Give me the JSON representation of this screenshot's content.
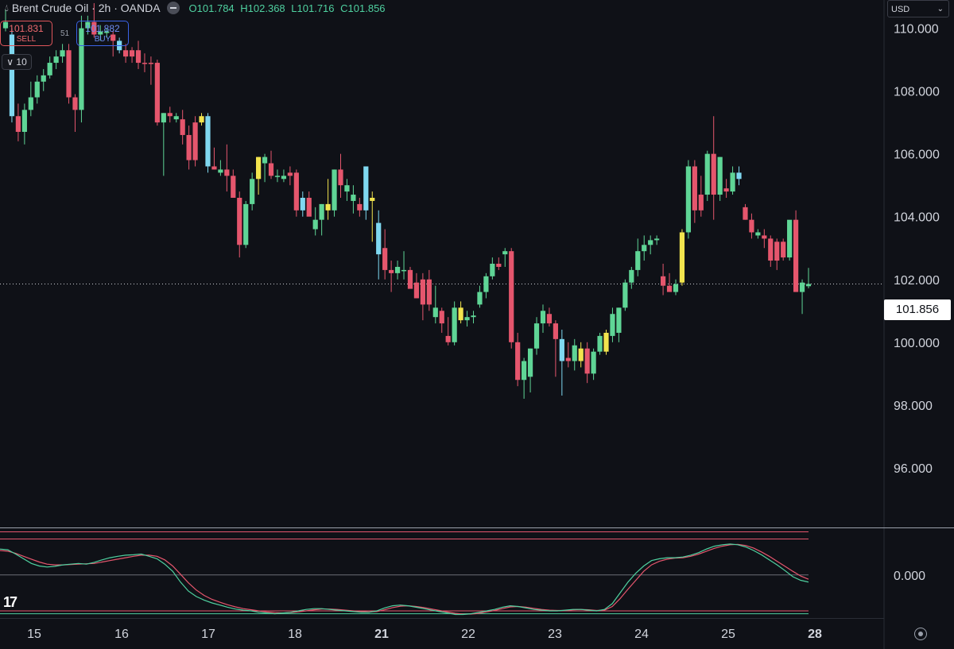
{
  "header": {
    "symbol_line": "Brent Crude Oil · 2h · OANDA",
    "open": "O101.784",
    "high": "H102.368",
    "low": "L101.716",
    "close": "C101.856"
  },
  "trade": {
    "sell_price": "101.831",
    "sell_label": "SELL",
    "spread": "51",
    "buy_price": "101.882",
    "buy_label": "BUY"
  },
  "volume_toggle": "10",
  "currency": "USD",
  "current_price_label": "101.856",
  "logo_text": "17",
  "colors": {
    "bg": "#0f1117",
    "up": "#5fd596",
    "down": "#e5566d",
    "up_alt": "#7fd8f0",
    "down_alt": "#f2e44e",
    "osc_fast": "#4fd1a0",
    "osc_slow": "#e5566d",
    "osc_band": "#e5566d",
    "grid_line": "#3a3d47"
  },
  "chart_data": {
    "type": "candlestick",
    "y_axis": {
      "ticks": [
        "110.000",
        "108.000",
        "106.000",
        "104.000",
        "102.000",
        "100.000",
        "98.000",
        "96.000"
      ],
      "tick_values": [
        110,
        108,
        106,
        104,
        102,
        100,
        98,
        96
      ],
      "ylim": [
        94.1,
        110.9
      ]
    },
    "x_axis": {
      "ticks": [
        "15",
        "16",
        "17",
        "18",
        "21",
        "22",
        "23",
        "24",
        "25",
        "28"
      ],
      "bold_ticks": [
        "21",
        "28"
      ]
    },
    "current_price": 101.856,
    "candles": [
      {
        "o": 110.2,
        "h": 110.6,
        "l": 109.9,
        "c": 110.0,
        "s": "up"
      },
      {
        "o": 109.8,
        "h": 110.0,
        "l": 107.0,
        "c": 107.2,
        "s": "up_alt"
      },
      {
        "o": 107.2,
        "h": 107.6,
        "l": 106.4,
        "c": 106.7,
        "s": "down"
      },
      {
        "o": 106.7,
        "h": 107.6,
        "l": 106.3,
        "c": 107.4,
        "s": "up"
      },
      {
        "o": 107.4,
        "h": 108.3,
        "l": 107.2,
        "c": 107.8,
        "s": "up"
      },
      {
        "o": 107.8,
        "h": 108.5,
        "l": 107.6,
        "c": 108.3,
        "s": "up"
      },
      {
        "o": 108.3,
        "h": 108.7,
        "l": 108.0,
        "c": 108.5,
        "s": "up"
      },
      {
        "o": 108.5,
        "h": 109.1,
        "l": 108.4,
        "c": 108.9,
        "s": "up"
      },
      {
        "o": 108.9,
        "h": 109.3,
        "l": 108.7,
        "c": 109.1,
        "s": "up"
      },
      {
        "o": 109.1,
        "h": 109.5,
        "l": 108.9,
        "c": 109.3,
        "s": "up"
      },
      {
        "o": 109.3,
        "h": 109.5,
        "l": 107.6,
        "c": 107.8,
        "s": "down"
      },
      {
        "o": 107.8,
        "h": 107.9,
        "l": 106.7,
        "c": 107.4,
        "s": "down"
      },
      {
        "o": 107.4,
        "h": 110.4,
        "l": 107.0,
        "c": 110.0,
        "s": "up"
      },
      {
        "o": 110.0,
        "h": 110.4,
        "l": 109.8,
        "c": 110.2,
        "s": "up"
      },
      {
        "o": 110.2,
        "h": 110.8,
        "l": 109.7,
        "c": 109.8,
        "s": "down"
      },
      {
        "o": 109.8,
        "h": 110.1,
        "l": 109.6,
        "c": 109.9,
        "s": "up"
      },
      {
        "o": 109.9,
        "h": 110.0,
        "l": 109.7,
        "c": 109.85,
        "s": "up"
      },
      {
        "o": 109.8,
        "h": 109.9,
        "l": 109.1,
        "c": 109.6,
        "s": "down"
      },
      {
        "o": 109.6,
        "h": 109.7,
        "l": 109.2,
        "c": 109.3,
        "s": "up_alt"
      },
      {
        "o": 109.3,
        "h": 109.5,
        "l": 108.9,
        "c": 109.1,
        "s": "down"
      },
      {
        "o": 109.1,
        "h": 109.4,
        "l": 108.9,
        "c": 109.3,
        "s": "down"
      },
      {
        "o": 109.3,
        "h": 109.6,
        "l": 108.7,
        "c": 108.9,
        "s": "down"
      },
      {
        "o": 108.9,
        "h": 109.2,
        "l": 108.6,
        "c": 108.9,
        "s": "down"
      },
      {
        "o": 108.9,
        "h": 109.1,
        "l": 108.2,
        "c": 108.9,
        "s": "down"
      },
      {
        "o": 108.9,
        "h": 109.0,
        "l": 106.9,
        "c": 107.0,
        "s": "down"
      },
      {
        "o": 107.0,
        "h": 107.3,
        "l": 105.3,
        "c": 107.3,
        "s": "up"
      },
      {
        "o": 107.3,
        "h": 107.5,
        "l": 107.0,
        "c": 107.2,
        "s": "down"
      },
      {
        "o": 107.2,
        "h": 107.3,
        "l": 107.0,
        "c": 107.1,
        "s": "up"
      },
      {
        "o": 107.1,
        "h": 107.4,
        "l": 106.3,
        "c": 106.6,
        "s": "down"
      },
      {
        "o": 106.6,
        "h": 106.9,
        "l": 105.5,
        "c": 105.8,
        "s": "down"
      },
      {
        "o": 105.8,
        "h": 107.2,
        "l": 105.6,
        "c": 107.0,
        "s": "down"
      },
      {
        "o": 107.0,
        "h": 107.3,
        "l": 106.9,
        "c": 107.2,
        "s": "down_alt"
      },
      {
        "o": 107.2,
        "h": 107.3,
        "l": 105.4,
        "c": 105.6,
        "s": "up_alt"
      },
      {
        "o": 105.6,
        "h": 106.2,
        "l": 105.5,
        "c": 105.5,
        "s": "down"
      },
      {
        "o": 105.5,
        "h": 105.8,
        "l": 105.3,
        "c": 105.4,
        "s": "up"
      },
      {
        "o": 105.5,
        "h": 106.3,
        "l": 104.8,
        "c": 105.3,
        "s": "down"
      },
      {
        "o": 105.3,
        "h": 105.5,
        "l": 104.6,
        "c": 104.6,
        "s": "down"
      },
      {
        "o": 104.6,
        "h": 104.8,
        "l": 102.7,
        "c": 103.1,
        "s": "down"
      },
      {
        "o": 103.1,
        "h": 104.5,
        "l": 103.0,
        "c": 104.4,
        "s": "up"
      },
      {
        "o": 104.4,
        "h": 105.4,
        "l": 104.2,
        "c": 105.2,
        "s": "up"
      },
      {
        "o": 105.2,
        "h": 105.9,
        "l": 104.7,
        "c": 105.9,
        "s": "down_alt"
      },
      {
        "o": 105.9,
        "h": 106.0,
        "l": 105.1,
        "c": 105.7,
        "s": "up"
      },
      {
        "o": 105.7,
        "h": 106.1,
        "l": 105.2,
        "c": 105.3,
        "s": "down"
      },
      {
        "o": 105.3,
        "h": 105.5,
        "l": 105.1,
        "c": 105.3,
        "s": "up"
      },
      {
        "o": 105.3,
        "h": 105.5,
        "l": 105.1,
        "c": 105.2,
        "s": "up"
      },
      {
        "o": 105.3,
        "h": 105.6,
        "l": 105.0,
        "c": 105.4,
        "s": "down"
      },
      {
        "o": 105.4,
        "h": 105.5,
        "l": 104.0,
        "c": 104.2,
        "s": "down"
      },
      {
        "o": 104.2,
        "h": 104.8,
        "l": 104.0,
        "c": 104.6,
        "s": "up_alt"
      },
      {
        "o": 104.6,
        "h": 104.8,
        "l": 104.1,
        "c": 104.0,
        "s": "down"
      },
      {
        "o": 103.6,
        "h": 104.3,
        "l": 103.4,
        "c": 103.9,
        "s": "up"
      },
      {
        "o": 103.9,
        "h": 104.4,
        "l": 103.4,
        "c": 104.4,
        "s": "up"
      },
      {
        "o": 104.4,
        "h": 105.2,
        "l": 103.9,
        "c": 104.2,
        "s": "down_alt"
      },
      {
        "o": 104.2,
        "h": 105.5,
        "l": 104.0,
        "c": 105.5,
        "s": "up"
      },
      {
        "o": 105.5,
        "h": 106.0,
        "l": 104.6,
        "c": 105.0,
        "s": "down"
      },
      {
        "o": 105.0,
        "h": 105.2,
        "l": 104.5,
        "c": 104.8,
        "s": "up"
      },
      {
        "o": 104.7,
        "h": 105.0,
        "l": 104.1,
        "c": 104.5,
        "s": "up"
      },
      {
        "o": 104.4,
        "h": 104.6,
        "l": 104.0,
        "c": 104.2,
        "s": "down"
      },
      {
        "o": 104.2,
        "h": 105.6,
        "l": 103.9,
        "c": 105.6,
        "s": "up_alt"
      },
      {
        "o": 104.6,
        "h": 104.8,
        "l": 103.2,
        "c": 104.5,
        "s": "down_alt"
      },
      {
        "o": 103.8,
        "h": 104.2,
        "l": 102.0,
        "c": 102.8,
        "s": "up_alt"
      },
      {
        "o": 103.0,
        "h": 103.6,
        "l": 102.0,
        "c": 102.3,
        "s": "down"
      },
      {
        "o": 102.3,
        "h": 102.6,
        "l": 101.6,
        "c": 102.2,
        "s": "down"
      },
      {
        "o": 102.2,
        "h": 102.6,
        "l": 102.0,
        "c": 102.4,
        "s": "up"
      },
      {
        "o": 102.3,
        "h": 102.9,
        "l": 102.0,
        "c": 102.3,
        "s": "up"
      },
      {
        "o": 102.3,
        "h": 102.4,
        "l": 101.9,
        "c": 101.7,
        "s": "down"
      },
      {
        "o": 101.9,
        "h": 102.2,
        "l": 101.4,
        "c": 101.4,
        "s": "down"
      },
      {
        "o": 101.2,
        "h": 102.2,
        "l": 100.7,
        "c": 102.0,
        "s": "down"
      },
      {
        "o": 102.0,
        "h": 102.3,
        "l": 101.0,
        "c": 101.2,
        "s": "down"
      },
      {
        "o": 101.1,
        "h": 101.8,
        "l": 100.6,
        "c": 100.8,
        "s": "up"
      },
      {
        "o": 100.6,
        "h": 101.1,
        "l": 100.3,
        "c": 101.0,
        "s": "down"
      },
      {
        "o": 100.2,
        "h": 100.8,
        "l": 99.9,
        "c": 100.0,
        "s": "down"
      },
      {
        "o": 100.0,
        "h": 101.3,
        "l": 99.9,
        "c": 101.1,
        "s": "up"
      },
      {
        "o": 101.1,
        "h": 101.3,
        "l": 100.6,
        "c": 100.7,
        "s": "down_alt"
      },
      {
        "o": 100.7,
        "h": 101.0,
        "l": 100.5,
        "c": 100.8,
        "s": "up"
      },
      {
        "o": 100.8,
        "h": 101.0,
        "l": 100.6,
        "c": 100.85,
        "s": "up"
      },
      {
        "o": 101.2,
        "h": 101.8,
        "l": 101.1,
        "c": 101.6,
        "s": "up"
      },
      {
        "o": 101.6,
        "h": 102.2,
        "l": 101.4,
        "c": 102.1,
        "s": "up"
      },
      {
        "o": 102.1,
        "h": 102.7,
        "l": 102.0,
        "c": 102.5,
        "s": "up"
      },
      {
        "o": 102.5,
        "h": 102.7,
        "l": 102.3,
        "c": 102.4,
        "s": "down"
      },
      {
        "o": 102.8,
        "h": 103.0,
        "l": 102.4,
        "c": 102.9,
        "s": "up"
      },
      {
        "o": 102.9,
        "h": 103.0,
        "l": 99.8,
        "c": 100.0,
        "s": "down"
      },
      {
        "o": 100.0,
        "h": 100.3,
        "l": 98.6,
        "c": 98.8,
        "s": "down"
      },
      {
        "o": 98.8,
        "h": 99.5,
        "l": 98.2,
        "c": 99.4,
        "s": "up"
      },
      {
        "o": 98.9,
        "h": 99.8,
        "l": 98.4,
        "c": 99.8,
        "s": "up"
      },
      {
        "o": 99.8,
        "h": 100.8,
        "l": 99.6,
        "c": 100.6,
        "s": "up"
      },
      {
        "o": 100.6,
        "h": 101.2,
        "l": 100.3,
        "c": 101.0,
        "s": "up"
      },
      {
        "o": 100.9,
        "h": 101.1,
        "l": 100.5,
        "c": 100.6,
        "s": "down"
      },
      {
        "o": 100.6,
        "h": 100.7,
        "l": 98.9,
        "c": 100.1,
        "s": "down"
      },
      {
        "o": 100.1,
        "h": 100.4,
        "l": 98.3,
        "c": 99.4,
        "s": "up_alt"
      },
      {
        "o": 99.4,
        "h": 100.0,
        "l": 99.2,
        "c": 99.5,
        "s": "down"
      },
      {
        "o": 99.4,
        "h": 100.1,
        "l": 99.1,
        "c": 99.9,
        "s": "up"
      },
      {
        "o": 99.4,
        "h": 100.0,
        "l": 99.2,
        "c": 99.8,
        "s": "down_alt"
      },
      {
        "o": 99.8,
        "h": 100.0,
        "l": 98.7,
        "c": 99.0,
        "s": "down"
      },
      {
        "o": 99.0,
        "h": 99.8,
        "l": 98.8,
        "c": 99.7,
        "s": "up"
      },
      {
        "o": 99.7,
        "h": 100.3,
        "l": 99.6,
        "c": 100.2,
        "s": "up"
      },
      {
        "o": 99.7,
        "h": 100.4,
        "l": 99.6,
        "c": 100.3,
        "s": "down_alt"
      },
      {
        "o": 100.2,
        "h": 101.1,
        "l": 100.0,
        "c": 100.9,
        "s": "up"
      },
      {
        "o": 100.3,
        "h": 101.1,
        "l": 100.0,
        "c": 101.1,
        "s": "up"
      },
      {
        "o": 101.1,
        "h": 102.0,
        "l": 101.0,
        "c": 101.9,
        "s": "up"
      },
      {
        "o": 101.9,
        "h": 102.4,
        "l": 101.7,
        "c": 102.3,
        "s": "up"
      },
      {
        "o": 102.3,
        "h": 103.3,
        "l": 102.1,
        "c": 102.9,
        "s": "up"
      },
      {
        "o": 102.9,
        "h": 103.4,
        "l": 102.6,
        "c": 103.1,
        "s": "up"
      },
      {
        "o": 103.1,
        "h": 103.4,
        "l": 102.8,
        "c": 103.25,
        "s": "up"
      },
      {
        "o": 103.25,
        "h": 103.4,
        "l": 103.1,
        "c": 103.3,
        "s": "up"
      },
      {
        "o": 102.1,
        "h": 102.5,
        "l": 101.5,
        "c": 101.8,
        "s": "down"
      },
      {
        "o": 101.8,
        "h": 102.2,
        "l": 101.7,
        "c": 101.6,
        "s": "down"
      },
      {
        "o": 101.6,
        "h": 102.0,
        "l": 101.5,
        "c": 101.85,
        "s": "up"
      },
      {
        "o": 101.9,
        "h": 103.6,
        "l": 101.8,
        "c": 103.5,
        "s": "down_alt"
      },
      {
        "o": 103.5,
        "h": 105.8,
        "l": 103.3,
        "c": 105.6,
        "s": "up"
      },
      {
        "o": 104.2,
        "h": 105.8,
        "l": 103.8,
        "c": 105.6,
        "s": "down"
      },
      {
        "o": 104.2,
        "h": 105.3,
        "l": 104.0,
        "c": 104.7,
        "s": "down"
      },
      {
        "o": 104.7,
        "h": 106.1,
        "l": 104.5,
        "c": 106.0,
        "s": "up"
      },
      {
        "o": 106.0,
        "h": 107.2,
        "l": 103.9,
        "c": 104.7,
        "s": "down"
      },
      {
        "o": 104.7,
        "h": 105.9,
        "l": 104.5,
        "c": 105.9,
        "s": "up"
      },
      {
        "o": 104.9,
        "h": 105.2,
        "l": 104.6,
        "c": 104.8,
        "s": "down"
      },
      {
        "o": 104.8,
        "h": 105.6,
        "l": 104.7,
        "c": 105.4,
        "s": "up"
      },
      {
        "o": 105.4,
        "h": 105.6,
        "l": 105.0,
        "c": 105.2,
        "s": "up_alt"
      },
      {
        "o": 104.3,
        "h": 104.4,
        "l": 103.9,
        "c": 103.9,
        "s": "down"
      },
      {
        "o": 103.9,
        "h": 104.1,
        "l": 103.3,
        "c": 103.5,
        "s": "down"
      },
      {
        "o": 103.5,
        "h": 103.6,
        "l": 103.3,
        "c": 103.4,
        "s": "up"
      },
      {
        "o": 103.4,
        "h": 103.6,
        "l": 103.0,
        "c": 103.3,
        "s": "down"
      },
      {
        "o": 103.3,
        "h": 103.4,
        "l": 102.4,
        "c": 102.6,
        "s": "down"
      },
      {
        "o": 102.6,
        "h": 103.3,
        "l": 102.3,
        "c": 103.2,
        "s": "down"
      },
      {
        "o": 103.2,
        "h": 103.3,
        "l": 102.6,
        "c": 102.7,
        "s": "down"
      },
      {
        "o": 102.7,
        "h": 103.4,
        "l": 102.6,
        "c": 103.9,
        "s": "up"
      },
      {
        "o": 103.9,
        "h": 104.2,
        "l": 101.6,
        "c": 101.6,
        "s": "down"
      },
      {
        "o": 101.6,
        "h": 102.0,
        "l": 100.9,
        "c": 101.9,
        "s": "up"
      },
      {
        "o": 101.784,
        "h": 102.368,
        "l": 101.716,
        "c": 101.856,
        "s": "up"
      }
    ],
    "oscillator": {
      "y_ticks": [
        "0.000"
      ],
      "levels": [
        100,
        0,
        -100
      ],
      "ylim": [
        -120,
        130
      ],
      "fast": [
        72,
        70,
        58,
        45,
        32,
        25,
        22,
        24,
        28,
        30,
        32,
        30,
        35,
        42,
        48,
        52,
        55,
        56,
        58,
        52,
        45,
        30,
        10,
        -20,
        -45,
        -60,
        -70,
        -78,
        -84,
        -90,
        -95,
        -98,
        -100,
        -104,
        -106,
        -108,
        -106,
        -104,
        -100,
        -96,
        -94,
        -94,
        -96,
        -98,
        -100,
        -102,
        -104,
        -104,
        -100,
        -92,
        -86,
        -84,
        -86,
        -90,
        -94,
        -98,
        -102,
        -106,
        -110,
        -110,
        -108,
        -104,
        -100,
        -96,
        -90,
        -86,
        -88,
        -92,
        -96,
        -98,
        -100,
        -100,
        -98,
        -96,
        -96,
        -98,
        -100,
        -96,
        -80,
        -50,
        -20,
        5,
        25,
        40,
        45,
        48,
        48,
        50,
        55,
        62,
        72,
        80,
        84,
        86,
        84,
        78,
        68,
        56,
        42,
        28,
        12,
        -5,
        -15,
        -20
      ],
      "slow": [
        68,
        66,
        60,
        52,
        44,
        36,
        30,
        28,
        28,
        29,
        30,
        31,
        32,
        36,
        40,
        44,
        48,
        52,
        55,
        55,
        52,
        42,
        25,
        2,
        -22,
        -42,
        -57,
        -68,
        -76,
        -83,
        -89,
        -94,
        -97,
        -100,
        -103,
        -105,
        -106,
        -105,
        -103,
        -100,
        -97,
        -95,
        -95,
        -96,
        -98,
        -100,
        -102,
        -103,
        -102,
        -97,
        -91,
        -87,
        -86,
        -88,
        -91,
        -95,
        -99,
        -103,
        -107,
        -109,
        -109,
        -107,
        -103,
        -99,
        -94,
        -89,
        -88,
        -90,
        -93,
        -96,
        -98,
        -99,
        -99,
        -97,
        -96,
        -97,
        -99,
        -98,
        -88,
        -66,
        -40,
        -15,
        10,
        28,
        38,
        44,
        47,
        48,
        52,
        58,
        66,
        74,
        80,
        84,
        85,
        82,
        75,
        64,
        52,
        38,
        24,
        10,
        -3,
        -12
      ]
    }
  }
}
